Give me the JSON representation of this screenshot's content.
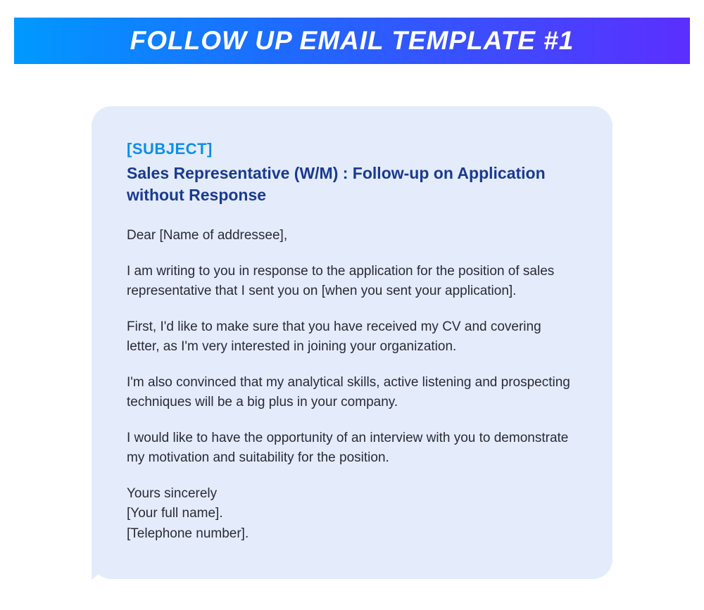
{
  "header": {
    "title": "FOLLOW UP EMAIL TEMPLATE #1"
  },
  "email": {
    "subject_label": "[SUBJECT]",
    "subject": "Sales Representative (W/M) : Follow-up on Application without Response",
    "greeting": "Dear [Name of addressee],",
    "paragraph1": "I am writing to you in response to the application for the position of sales representative that I sent you on [when you sent your application].",
    "paragraph2": "First, I'd like to make sure that you have received my CV and covering letter, as I'm very interested in joining your organization.",
    "paragraph3": "I'm also convinced that my analytical skills, active listening and prospecting techniques will be a big plus in your company.",
    "paragraph4": "I would like to have the opportunity of an interview with you to demonstrate my motivation and suitability for the position.",
    "signoff": "Yours sincerely",
    "name": "[Your full name].",
    "phone": "[Telephone number]."
  }
}
